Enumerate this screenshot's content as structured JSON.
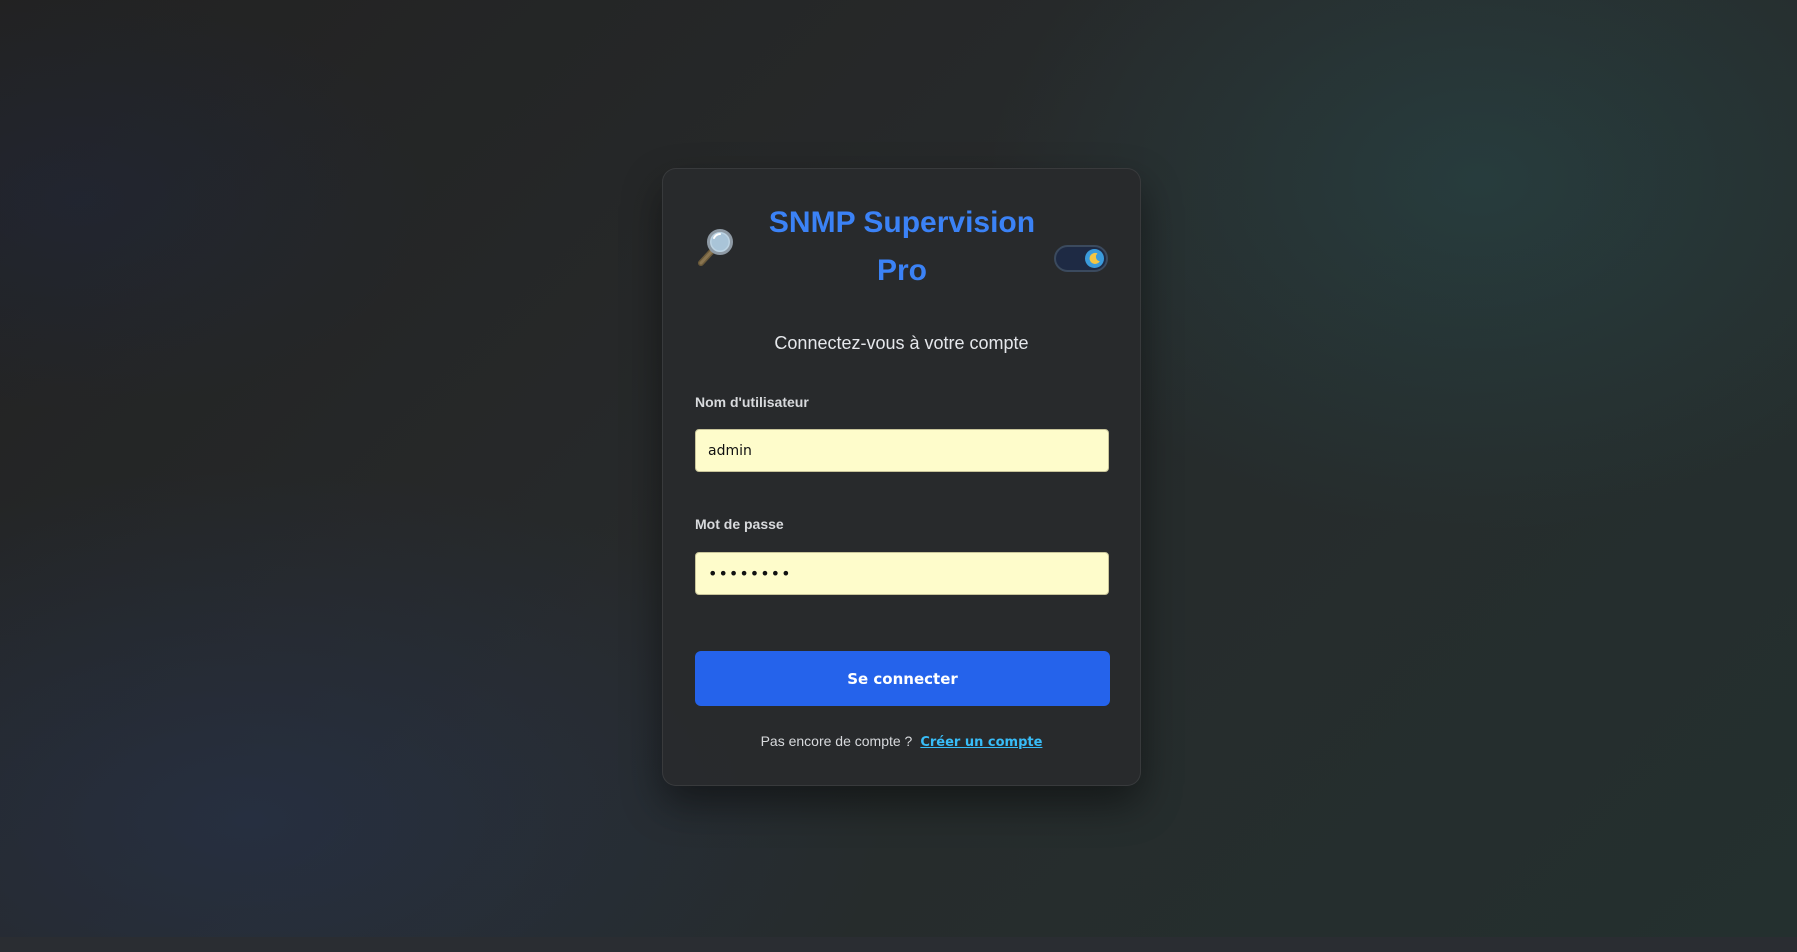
{
  "header": {
    "logo_icon": "magnifying-glass-icon",
    "title": "SNMP Supervision Pro",
    "theme_toggle": {
      "state": "dark",
      "icon": "moon-icon"
    }
  },
  "login": {
    "subtitle": "Connectez-vous à votre compte",
    "username": {
      "label": "Nom d'utilisateur",
      "value": "admin"
    },
    "password": {
      "label": "Mot de passe",
      "value": "••••••••"
    },
    "submit_label": "Se connecter"
  },
  "footer": {
    "text": "Pas encore de compte ?",
    "link_label": "Créer un compte"
  },
  "colors": {
    "accent": "#3b82f6",
    "button": "#2563eb",
    "link": "#38bdf8",
    "input_background": "#fefccb"
  }
}
